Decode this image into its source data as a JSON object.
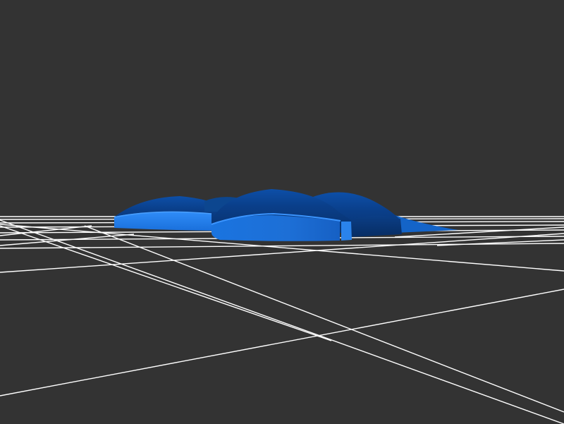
{
  "viewport": {
    "background_color": "#333333",
    "grid_color": "#ffffff",
    "model_color": "#1f7ae0",
    "model_shadow_color": "#0b3f85",
    "model_highlight_color": "#3b95ff"
  }
}
